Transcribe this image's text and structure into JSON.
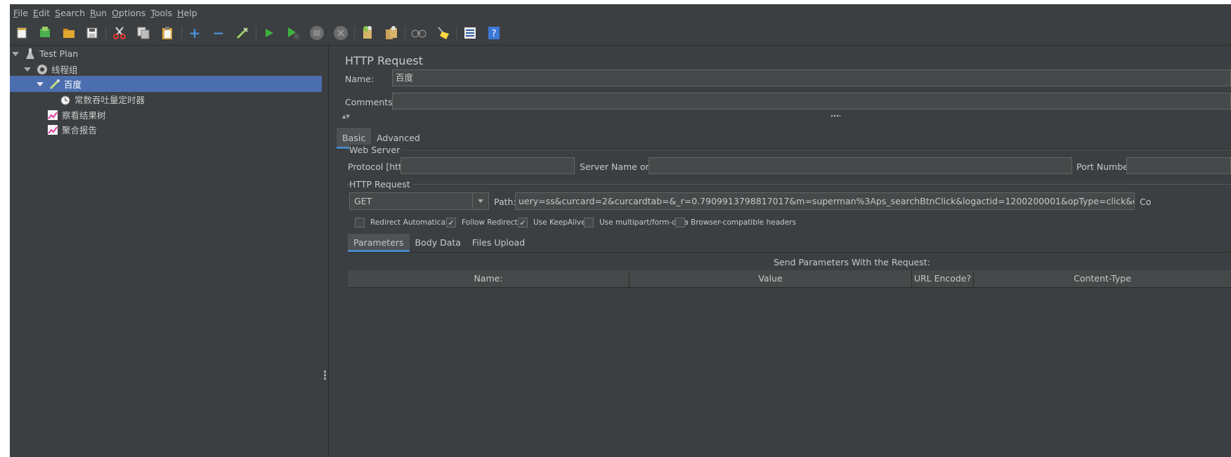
{
  "menu": [
    "File",
    "Edit",
    "Search",
    "Run",
    "Options",
    "Tools",
    "Help"
  ],
  "toolbar": {
    "icons": [
      "new-icon",
      "templates-icon",
      "open-icon",
      "save-icon",
      "cut-icon",
      "copy-icon",
      "paste-icon",
      "expand-icon",
      "collapse-icon",
      "toggle-icon",
      "start-icon",
      "start-no-pause-icon",
      "stop-icon",
      "shutdown-icon",
      "clear-icon",
      "clear-all-icon",
      "search-icon",
      "reset-search-icon",
      "function-helper-icon",
      "help-icon"
    ]
  },
  "tree": {
    "items": [
      {
        "label": "Test Plan",
        "icon": "flask-icon"
      },
      {
        "label": "线程组",
        "icon": "gear-icon"
      },
      {
        "label": "百度",
        "icon": "sampler-icon"
      },
      {
        "label": "常数吞吐量定时器",
        "icon": "timer-icon"
      },
      {
        "label": "察看结果树",
        "icon": "listener-icon"
      },
      {
        "label": "聚合报告",
        "icon": "listener-icon"
      }
    ]
  },
  "panel": {
    "title": "HTTP Request",
    "name_label": "Name:",
    "name_value": "百度",
    "comments_label": "Comments:",
    "comments_value": "",
    "tabs": [
      "Basic",
      "Advanced"
    ],
    "web_server": {
      "title": "Web Server",
      "protocol_label": "Protocol [http]:",
      "protocol_value": "",
      "server_label": "Server Name or IP:",
      "server_value": "",
      "port_label": "Port Number:",
      "port_value": ""
    },
    "http_request": {
      "title": "HTTP Request",
      "method": "GET",
      "path_label": "Path:",
      "path_value": "uery=ss&curcard=2&curcardtab=&_r=0.7909913798817017&m=superman%3Aps_searchBtnClick&logactid=1200200001&opType=click&openMode=current&wd=ss&isSkin=false",
      "trailing_label": "Co"
    },
    "options": [
      {
        "label": "Redirect Automatically",
        "checked": false
      },
      {
        "label": "Follow Redirects",
        "checked": true
      },
      {
        "label": "Use KeepAlive",
        "checked": true
      },
      {
        "label": "Use multipart/form-data",
        "checked": false
      },
      {
        "label": "Browser-compatible headers",
        "checked": false
      }
    ],
    "sub_tabs": [
      "Parameters",
      "Body Data",
      "Files Upload"
    ],
    "params_title": "Send Parameters With the Request:",
    "columns": [
      "Name:",
      "Value",
      "URL Encode?",
      "Content-Type"
    ]
  }
}
